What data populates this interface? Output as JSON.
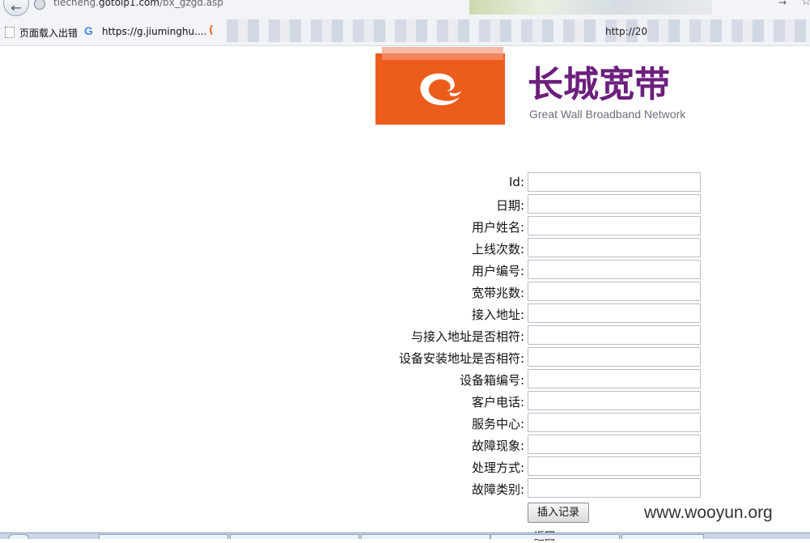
{
  "browser": {
    "url_prefix": "tiecheng.",
    "url_domain": "gotoip1.com",
    "url_path": "/bx_gzgd.asp",
    "bookmarks": {
      "page_loading": "页面载入出错",
      "g_link": "https://g.jiuminghu....",
      "http_partial": "http://20"
    }
  },
  "logo": {
    "brand_cn": "长城宽带",
    "brand_en": "Great Wall Broadband Network"
  },
  "form": {
    "fields": [
      {
        "label": "Id:",
        "value": ""
      },
      {
        "label": "日期:",
        "value": ""
      },
      {
        "label": "用户姓名:",
        "value": ""
      },
      {
        "label": "上线次数:",
        "value": ""
      },
      {
        "label": "用户编号:",
        "value": ""
      },
      {
        "label": "宽带兆数:",
        "value": ""
      },
      {
        "label": "接入地址:",
        "value": ""
      },
      {
        "label": "与接入地址是否相符:",
        "value": ""
      },
      {
        "label": "设备安装地址是否相符:",
        "value": ""
      },
      {
        "label": "设备箱编号:",
        "value": ""
      },
      {
        "label": "客户电话:",
        "value": ""
      },
      {
        "label": "服务中心:",
        "value": ""
      },
      {
        "label": "故障现象:",
        "value": ""
      },
      {
        "label": "处理方式:",
        "value": ""
      },
      {
        "label": "故障类别:",
        "value": ""
      }
    ],
    "submit_label": "插入记录",
    "back_label": "返回"
  },
  "watermark": "www.wooyun.org",
  "colors": {
    "logo_orange": "#ec5d1c",
    "brand_purple": "#6c1f7c"
  }
}
